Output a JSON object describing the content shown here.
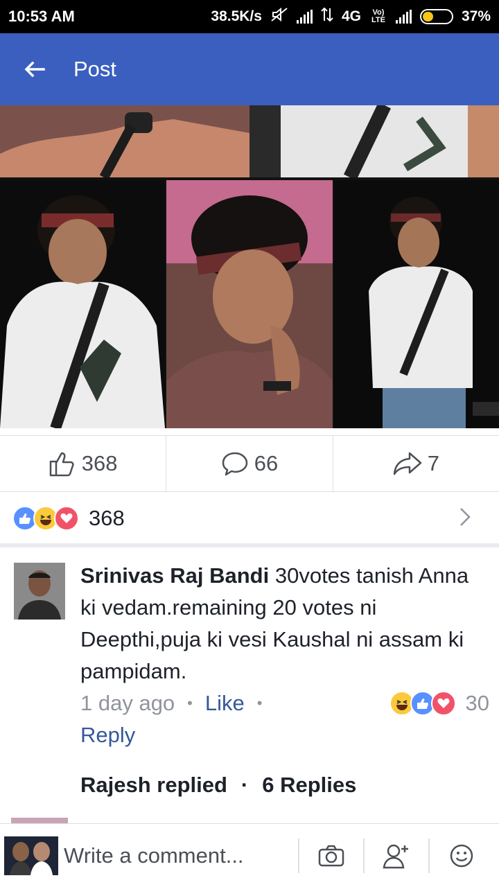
{
  "status_bar": {
    "time": "10:53 AM",
    "speed": "38.5K/s",
    "network": "4G",
    "volte": "Vo) LTE",
    "battery": "37%",
    "battery_level": 0.37
  },
  "app_bar": {
    "title": "Post",
    "back_icon": "arrow-left-icon"
  },
  "actions": {
    "likes": "368",
    "comments": "66",
    "shares": "7"
  },
  "reactions": {
    "count": "368",
    "icons": [
      "like-icon",
      "haha-icon",
      "love-icon"
    ]
  },
  "comment": {
    "author": "Srinivas Raj Bandi",
    "text": "30votes tanish Anna ki vedam.remaining 20 votes ni Deepthi,puja ki vesi Kaushal  ni assam ki pampidam.",
    "time": "1 day ago",
    "like_label": "Like",
    "reply_label": "Reply",
    "reaction_count": "30",
    "replies_by": "Rajesh replied",
    "replies_count": "6 Replies"
  },
  "write_bar": {
    "placeholder": "Write a comment..."
  },
  "colors": {
    "brand": "#3b5fbf",
    "link": "#365899",
    "like_blue": "#5890ff",
    "love_red": "#f25268",
    "haha_yellow": "#fcc93a"
  }
}
